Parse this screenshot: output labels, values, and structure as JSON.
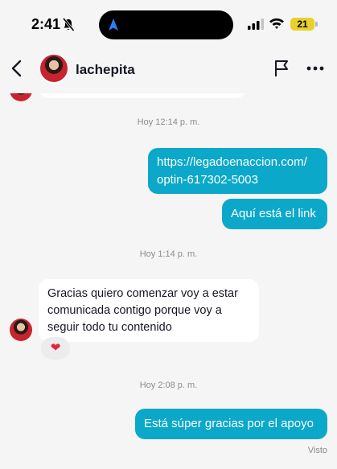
{
  "status_bar": {
    "time": "2:41",
    "battery": "21",
    "battery_color": "#e8d12a"
  },
  "header": {
    "username": "lachepita"
  },
  "chat": {
    "messages": [
      {
        "type": "timestamp",
        "text": "Hoy 12:14 p. m."
      },
      {
        "type": "outgoing",
        "lines": [
          "https://legadoenaccion.com/",
          "optin-617302-5003"
        ]
      },
      {
        "type": "outgoing",
        "text": "Aquí está el link"
      },
      {
        "type": "timestamp",
        "text": "Hoy 1:14 p. m."
      },
      {
        "type": "incoming",
        "lines": [
          "Gracias quiero comenzar voy a estar",
          "comunicada contigo porque voy a",
          "seguir todo tu contenido"
        ],
        "reaction": "heart-icon"
      },
      {
        "type": "timestamp",
        "text": "Hoy 2:08 p. m."
      },
      {
        "type": "outgoing",
        "text": "Está súper gracias por el apoyo"
      }
    ],
    "seen_label": "Visto"
  },
  "colors": {
    "outgoing_bubble": "#0ba8c9",
    "incoming_bubble": "#ffffff",
    "background": "#f5f5f5"
  }
}
